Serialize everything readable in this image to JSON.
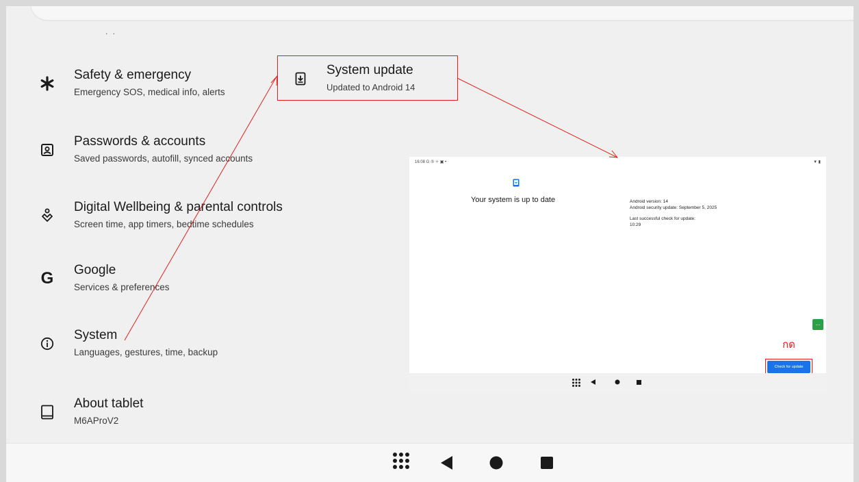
{
  "settings": {
    "top_hint": ". .",
    "items": [
      {
        "title": "Safety & emergency",
        "subtitle": "Emergency SOS, medical info, alerts",
        "icon": "asterisk-icon"
      },
      {
        "title": "Passwords & accounts",
        "subtitle": "Saved passwords, autofill, synced accounts",
        "icon": "account-box-icon"
      },
      {
        "title": "Digital Wellbeing & parental controls",
        "subtitle": "Screen time, app timers, bedtime schedules",
        "icon": "wellbeing-icon"
      },
      {
        "title": "Google",
        "subtitle": "Services & preferences",
        "icon": "google-icon"
      },
      {
        "title": "System",
        "subtitle": "Languages, gestures, time, backup",
        "icon": "info-icon"
      },
      {
        "title": "About tablet",
        "subtitle": "M6AProV2",
        "icon": "tablet-icon"
      }
    ]
  },
  "system_update": {
    "title": "System update",
    "subtitle": "Updated to Android 14",
    "icon": "system-update-icon"
  },
  "inset": {
    "status_time": "16:08 G ⑤ ✧ ▣ •",
    "status_right": "▼ ▮",
    "up_to_date": "Your system is up to date",
    "android_version": "Android version: 14",
    "security_update": "Android security update: September 5, 2025",
    "last_check_label": "Last successful check for update:",
    "last_check_time": "10:29",
    "annotation_thai": "กด",
    "check_button": "Check for update",
    "green_badge": "..."
  },
  "colors": {
    "annotation_red": "#e02020",
    "button_blue": "#1a73e8",
    "badge_green": "#2e9e48"
  }
}
